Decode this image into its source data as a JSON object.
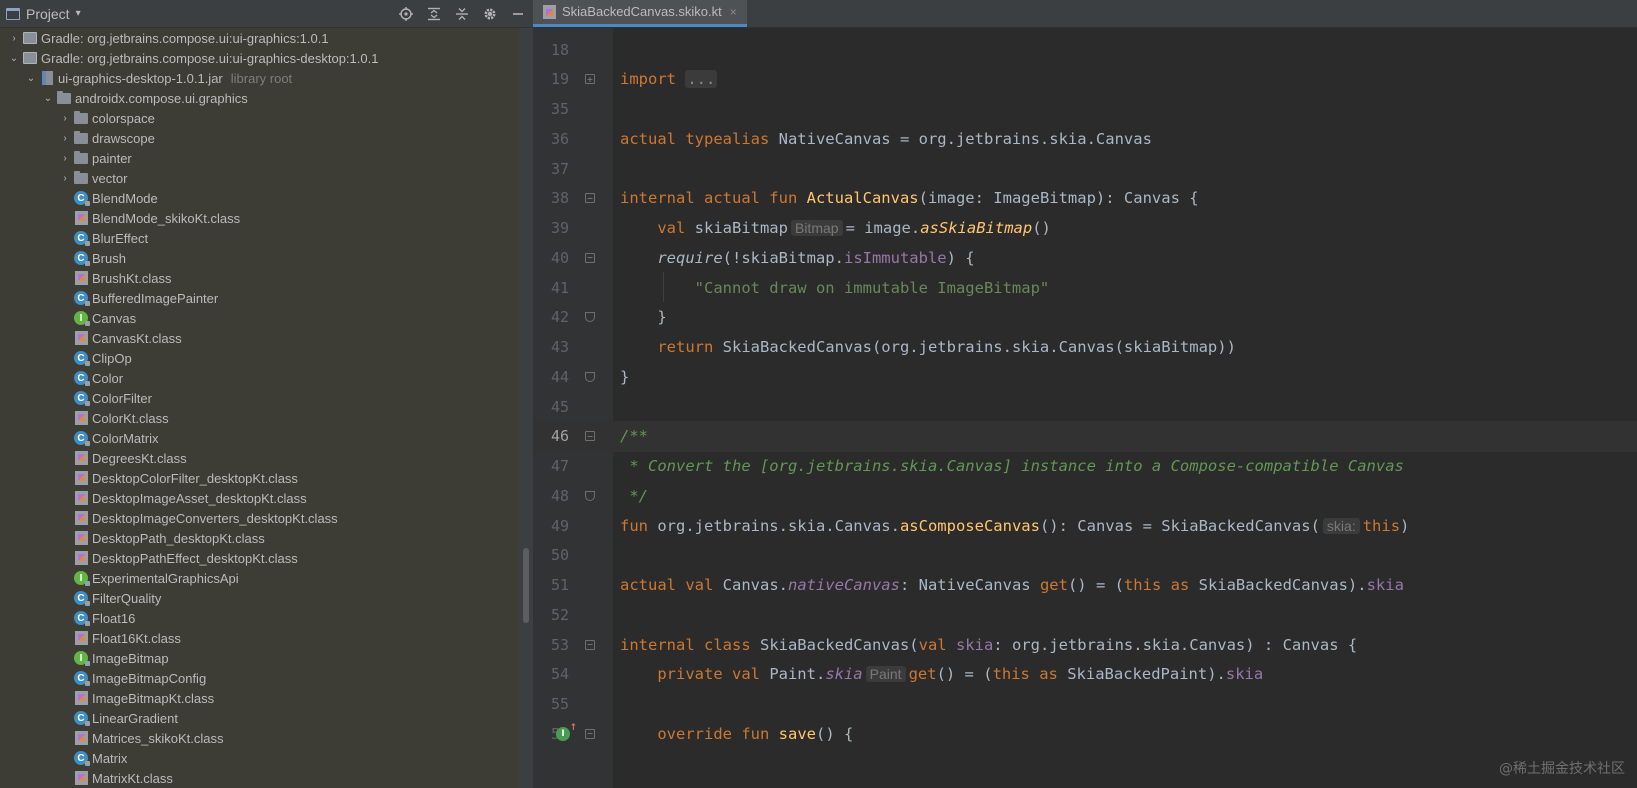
{
  "project_panel": {
    "title": "Project",
    "caret": "▾",
    "tools": [
      {
        "name": "locate-icon"
      },
      {
        "name": "expand-all-icon"
      },
      {
        "name": "collapse-all-icon"
      },
      {
        "name": "gear-icon"
      },
      {
        "name": "minimize-icon"
      }
    ],
    "tree": [
      {
        "level": 1,
        "arrow": "›",
        "icon": "gradle",
        "label": "Gradle: org.jetbrains.compose.ui:ui-graphics:1.0.1"
      },
      {
        "level": 1,
        "arrow": "⌄",
        "icon": "gradle",
        "label": "Gradle: org.jetbrains.compose.ui:ui-graphics-desktop:1.0.1"
      },
      {
        "level": 2,
        "arrow": "⌄",
        "icon": "jar",
        "label": "ui-graphics-desktop-1.0.1.jar",
        "extra": "library root"
      },
      {
        "level": 3,
        "arrow": "⌄",
        "icon": "folder",
        "label": "androidx.compose.ui.graphics"
      },
      {
        "level": 4,
        "arrow": "›",
        "icon": "folder",
        "label": "colorspace"
      },
      {
        "level": 4,
        "arrow": "›",
        "icon": "folder",
        "label": "drawscope"
      },
      {
        "level": 4,
        "arrow": "›",
        "icon": "folder",
        "label": "painter"
      },
      {
        "level": 4,
        "arrow": "›",
        "icon": "folder",
        "label": "vector"
      },
      {
        "level": 4,
        "arrow": "",
        "icon": "class",
        "label": "BlendMode"
      },
      {
        "level": 4,
        "arrow": "",
        "icon": "file",
        "label": "BlendMode_skikoKt.class"
      },
      {
        "level": 4,
        "arrow": "",
        "icon": "class",
        "label": "BlurEffect"
      },
      {
        "level": 4,
        "arrow": "",
        "icon": "class",
        "label": "Brush"
      },
      {
        "level": 4,
        "arrow": "",
        "icon": "file",
        "label": "BrushKt.class"
      },
      {
        "level": 4,
        "arrow": "",
        "icon": "class",
        "label": "BufferedImagePainter"
      },
      {
        "level": 4,
        "arrow": "",
        "icon": "interface",
        "label": "Canvas"
      },
      {
        "level": 4,
        "arrow": "",
        "icon": "file",
        "label": "CanvasKt.class"
      },
      {
        "level": 4,
        "arrow": "",
        "icon": "class",
        "label": "ClipOp"
      },
      {
        "level": 4,
        "arrow": "",
        "icon": "class",
        "label": "Color"
      },
      {
        "level": 4,
        "arrow": "",
        "icon": "class",
        "label": "ColorFilter"
      },
      {
        "level": 4,
        "arrow": "",
        "icon": "file",
        "label": "ColorKt.class"
      },
      {
        "level": 4,
        "arrow": "",
        "icon": "class",
        "label": "ColorMatrix"
      },
      {
        "level": 4,
        "arrow": "",
        "icon": "file",
        "label": "DegreesKt.class"
      },
      {
        "level": 4,
        "arrow": "",
        "icon": "file",
        "label": "DesktopColorFilter_desktopKt.class"
      },
      {
        "level": 4,
        "arrow": "",
        "icon": "file",
        "label": "DesktopImageAsset_desktopKt.class"
      },
      {
        "level": 4,
        "arrow": "",
        "icon": "file",
        "label": "DesktopImageConverters_desktopKt.class"
      },
      {
        "level": 4,
        "arrow": "",
        "icon": "file",
        "label": "DesktopPath_desktopKt.class"
      },
      {
        "level": 4,
        "arrow": "",
        "icon": "file",
        "label": "DesktopPathEffect_desktopKt.class"
      },
      {
        "level": 4,
        "arrow": "",
        "icon": "interface",
        "label": "ExperimentalGraphicsApi"
      },
      {
        "level": 4,
        "arrow": "",
        "icon": "class",
        "label": "FilterQuality"
      },
      {
        "level": 4,
        "arrow": "",
        "icon": "class",
        "label": "Float16"
      },
      {
        "level": 4,
        "arrow": "",
        "icon": "file",
        "label": "Float16Kt.class"
      },
      {
        "level": 4,
        "arrow": "",
        "icon": "interface",
        "label": "ImageBitmap"
      },
      {
        "level": 4,
        "arrow": "",
        "icon": "class",
        "label": "ImageBitmapConfig"
      },
      {
        "level": 4,
        "arrow": "",
        "icon": "file",
        "label": "ImageBitmapKt.class"
      },
      {
        "level": 4,
        "arrow": "",
        "icon": "class",
        "label": "LinearGradient"
      },
      {
        "level": 4,
        "arrow": "",
        "icon": "file",
        "label": "Matrices_skikoKt.class"
      },
      {
        "level": 4,
        "arrow": "",
        "icon": "class",
        "label": "Matrix"
      },
      {
        "level": 4,
        "arrow": "",
        "icon": "file",
        "label": "MatrixKt.class"
      }
    ]
  },
  "editor": {
    "tab": {
      "label": "SkiaBackedCanvas.skiko.kt",
      "close": "×"
    },
    "current_line": "46",
    "lines": [
      {
        "n": "18",
        "fold": "",
        "tokens": []
      },
      {
        "n": "19",
        "fold": "+",
        "tokens": [
          [
            "kw",
            "import "
          ],
          [
            "collapsed",
            "..."
          ]
        ]
      },
      {
        "n": "35",
        "fold": "",
        "tokens": []
      },
      {
        "n": "36",
        "fold": "",
        "tokens": [
          [
            "kw",
            "actual typealias "
          ],
          [
            "",
            "NativeCanvas = org.jetbrains.skia.Canvas"
          ]
        ]
      },
      {
        "n": "37",
        "fold": "",
        "tokens": []
      },
      {
        "n": "38",
        "fold": "-",
        "tokens": [
          [
            "kw",
            "internal actual fun "
          ],
          [
            "fn",
            "ActualCanvas"
          ],
          [
            "",
            "(image: ImageBitmap): Canvas {"
          ]
        ]
      },
      {
        "n": "39",
        "fold": "",
        "tokens": [
          [
            "",
            "    "
          ],
          [
            "kw",
            "val "
          ],
          [
            "",
            "skiaBitmap"
          ],
          [
            "hint",
            "Bitmap"
          ],
          [
            "",
            "= image."
          ],
          [
            "fn-it",
            "asSkiaBitmap"
          ],
          [
            "",
            "()"
          ]
        ]
      },
      {
        "n": "40",
        "fold": "-",
        "tokens": [
          [
            "",
            "    "
          ],
          [
            "it",
            "require"
          ],
          [
            "",
            "(!skiaBitmap."
          ],
          [
            "prop",
            "isImmutable"
          ],
          [
            "",
            ") {"
          ]
        ]
      },
      {
        "n": "41",
        "fold": "",
        "tokens": [
          [
            "",
            "        "
          ],
          [
            "str",
            "\"Cannot draw on immutable ImageBitmap\""
          ]
        ]
      },
      {
        "n": "42",
        "fold": "e",
        "tokens": [
          [
            "",
            "    }"
          ]
        ]
      },
      {
        "n": "43",
        "fold": "",
        "tokens": [
          [
            "",
            "    "
          ],
          [
            "kw",
            "return "
          ],
          [
            "",
            "SkiaBackedCanvas(org.jetbrains.skia.Canvas(skiaBitmap))"
          ]
        ]
      },
      {
        "n": "44",
        "fold": "e",
        "tokens": [
          [
            "",
            "}"
          ]
        ]
      },
      {
        "n": "45",
        "fold": "",
        "tokens": []
      },
      {
        "n": "46",
        "fold": "-",
        "tokens": [
          [
            "cm",
            "/**"
          ]
        ]
      },
      {
        "n": "47",
        "fold": "",
        "tokens": [
          [
            "cm",
            " * Convert the [org.jetbrains.skia.Canvas] instance into a Compose-compatible Canvas"
          ]
        ]
      },
      {
        "n": "48",
        "fold": "e",
        "tokens": [
          [
            "cm",
            " */"
          ]
        ]
      },
      {
        "n": "49",
        "fold": "",
        "tokens": [
          [
            "kw",
            "fun "
          ],
          [
            "",
            "org.jetbrains.skia.Canvas."
          ],
          [
            "fn",
            "asComposeCanvas"
          ],
          [
            "",
            "(): Canvas = SkiaBackedCanvas("
          ],
          [
            "hint",
            "skia:"
          ],
          [
            "kw",
            "this"
          ],
          [
            "",
            ")"
          ]
        ]
      },
      {
        "n": "50",
        "fold": "",
        "tokens": []
      },
      {
        "n": "51",
        "fold": "",
        "tokens": [
          [
            "kw",
            "actual val "
          ],
          [
            "",
            "Canvas."
          ],
          [
            "prop-it",
            "nativeCanvas"
          ],
          [
            "",
            ": NativeCanvas "
          ],
          [
            "kw",
            "get"
          ],
          [
            "",
            "() = ("
          ],
          [
            "kw",
            "this as "
          ],
          [
            "",
            "SkiaBackedCanvas)."
          ],
          [
            "prop",
            "skia"
          ]
        ]
      },
      {
        "n": "52",
        "fold": "",
        "tokens": []
      },
      {
        "n": "53",
        "fold": "-",
        "tokens": [
          [
            "kw",
            "internal class "
          ],
          [
            "",
            "SkiaBackedCanvas("
          ],
          [
            "kw",
            "val "
          ],
          [
            "prop",
            "skia"
          ],
          [
            "",
            ": org.jetbrains.skia.Canvas) : Canvas {"
          ]
        ]
      },
      {
        "n": "54",
        "fold": "",
        "tokens": [
          [
            "",
            "    "
          ],
          [
            "kw",
            "private val "
          ],
          [
            "",
            "Paint."
          ],
          [
            "prop-it",
            "skia"
          ],
          [
            "hint",
            "Paint"
          ],
          [
            "kw",
            "get"
          ],
          [
            "",
            "() = ("
          ],
          [
            "kw",
            "this as "
          ],
          [
            "",
            "SkiaBackedPaint)."
          ],
          [
            "prop",
            "skia"
          ]
        ]
      },
      {
        "n": "55",
        "fold": "",
        "tokens": []
      },
      {
        "n": "56",
        "fold": "-",
        "mark": "I",
        "tokens": [
          [
            "",
            "    "
          ],
          [
            "kw",
            "override fun "
          ],
          [
            "fn",
            "save"
          ],
          [
            "",
            "() {"
          ]
        ]
      }
    ]
  },
  "watermark": "@稀土掘金技术社区"
}
